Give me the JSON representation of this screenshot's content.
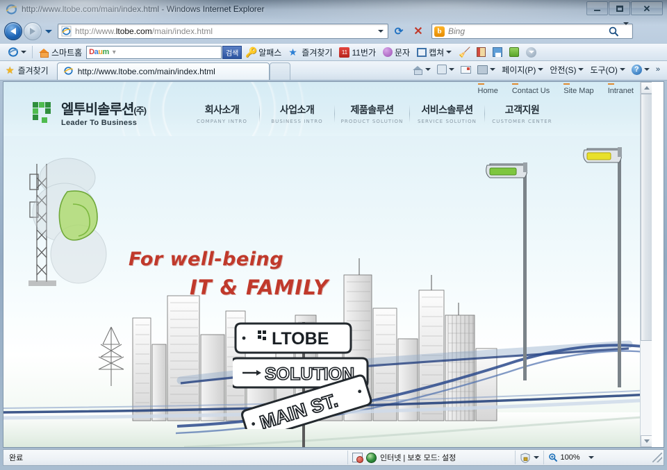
{
  "window": {
    "title": "http://www.ltobe.com/main/index.html - Windows Internet Explorer",
    "minimize_label": "Minimize",
    "maximize_label": "Maximize",
    "close_label": "Close"
  },
  "navigation": {
    "back_label": "Back",
    "forward_label": "Forward",
    "history_label": "Recent Pages",
    "refresh_label": "Refresh",
    "stop_label": "Stop",
    "url_scheme": "http://www.",
    "url_domain": "ltobe.com",
    "url_path": "/main/index.html",
    "url_full": "http://www.ltobe.com/main/index.html",
    "search_placeholder": "Bing",
    "search_provider_icon": "bing-icon",
    "search_glyph": "b"
  },
  "command_bar": {
    "ie_menu_label": "",
    "smart_home": "스마트홈",
    "daum_logo": "Daum",
    "daum_search_value": "",
    "daum_search_button": "검색",
    "alpass": "알패스",
    "favorites": "즐겨찾기",
    "eleven_street": "11번가",
    "message": "문자",
    "capture": "캡쳐",
    "items_icons": [
      "ie-icon",
      "home-icon",
      "daum-icon",
      "search-button",
      "key-icon",
      "star-icon",
      "eleven-icon",
      "message-icon",
      "capture-icon",
      "broom-icon",
      "book-icon",
      "save-icon",
      "green-icon",
      "grey-dropdown-icon"
    ]
  },
  "favorites_bar": {
    "favorites_label": "즐겨찾기",
    "tab_title": "http://www.ltobe.com/main/index.html",
    "new_tab_label": ""
  },
  "toolbar_right": {
    "home_label": "",
    "feeds_label": "",
    "mail_label": "",
    "print_label": "",
    "page_label": "페이지(P)",
    "safety_label": "안전(S)",
    "tools_label": "도구(O)",
    "help_label": "",
    "overflow_label": "»"
  },
  "site": {
    "logo": {
      "korean": "엘투비솔루션",
      "korean_suffix": "(주)",
      "english": "Leader To Business",
      "mark_color": "#3fa23f"
    },
    "utility_nav": [
      {
        "label": "Home"
      },
      {
        "label": "Contact Us"
      },
      {
        "label": "Site Map"
      },
      {
        "label": "Intranet"
      }
    ],
    "main_nav": [
      {
        "kr": "회사소개",
        "en": "COMPANY INTRO"
      },
      {
        "kr": "사업소개",
        "en": "BUSINESS INTRO"
      },
      {
        "kr": "제품솔루션",
        "en": "PRODUCT SOLUTION"
      },
      {
        "kr": "서비스솔루션",
        "en": "SERVICE SOLUTION"
      },
      {
        "kr": "고객지원",
        "en": "CUSTOMER CENTER"
      }
    ],
    "hero": {
      "tagline_line1": "For well-being",
      "tagline_line2": "IT & FAMILY",
      "tagline_color": "#c0392b",
      "street_signs": [
        {
          "text": "LTOBE"
        },
        {
          "text": "SOLUTION"
        },
        {
          "text": "MAIN ST."
        }
      ],
      "lamp_green": "#7ec63f",
      "lamp_yellow": "#e8e02a"
    }
  },
  "status_bar": {
    "status_text": "완료",
    "zone_text": "인터넷 | 보호 모드: 설정",
    "zoom_level": "100%",
    "zone_icon": "globe-icon",
    "blocked_icon": "popup-blocked-icon",
    "privacy_icon": "privacy-shield-icon",
    "zoom_icon": "zoom-magnifier-icon"
  }
}
